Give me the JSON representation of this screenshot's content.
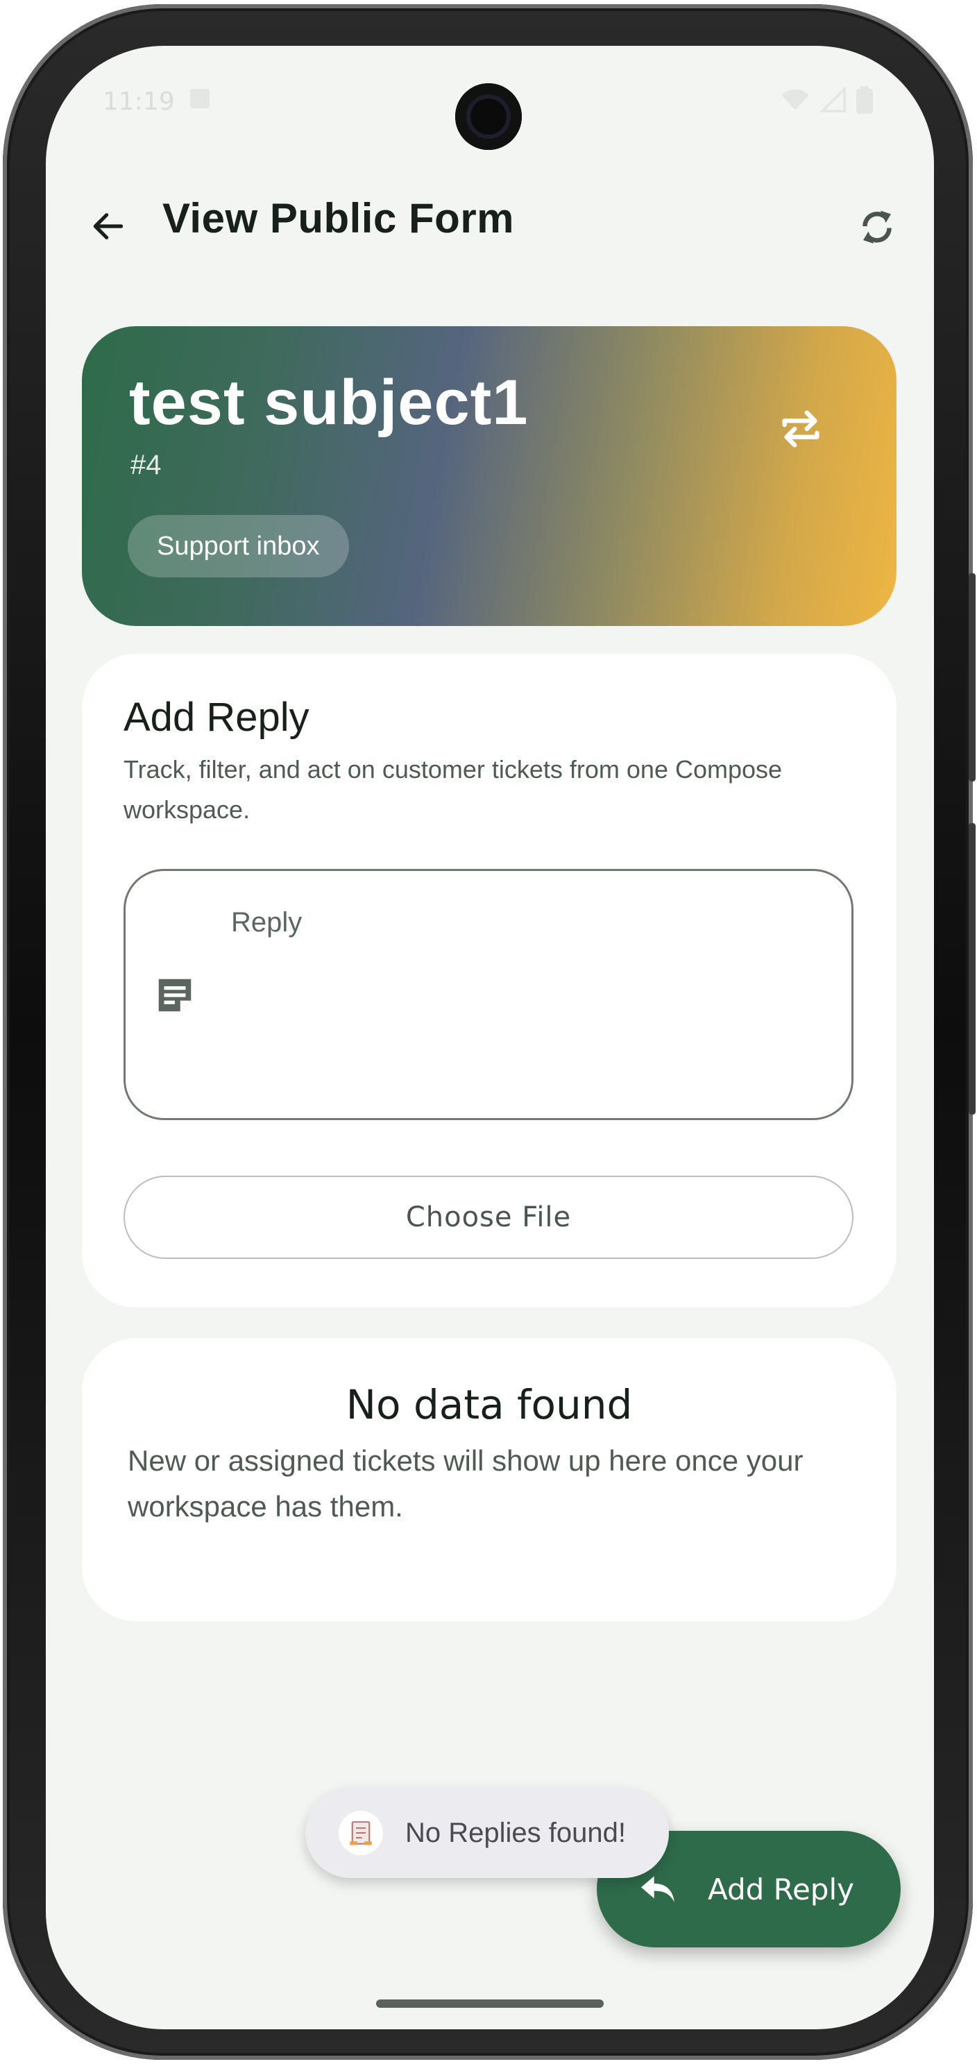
{
  "status_bar": {
    "time": "11:19",
    "icons": [
      "wifi-icon",
      "signal-icon",
      "battery-icon"
    ]
  },
  "app_bar": {
    "title": "View Public Form",
    "back_icon": "arrow-back-icon",
    "refresh_icon": "refresh-icon"
  },
  "ticket": {
    "subject": "test subject1",
    "number": "#4",
    "inbox_chip": "Support inbox",
    "swap_icon": "swap-arrows-icon"
  },
  "reply_card": {
    "title": "Add Reply",
    "subtitle": "Track, filter, and act on customer tickets from one Compose workspace.",
    "reply_placeholder": "Reply",
    "choose_file_label": "Choose File"
  },
  "empty_state": {
    "title": "No data found",
    "message": "New or assigned tickets will show up here once your workspace has them."
  },
  "toast": {
    "message": "No Replies found!"
  },
  "fab": {
    "label": "Add Reply",
    "icon": "reply-icon"
  },
  "colors": {
    "primary": "#2e6b4a",
    "background": "#f3f5f2",
    "card": "#ffffff",
    "gradient_end": "#efb643"
  }
}
